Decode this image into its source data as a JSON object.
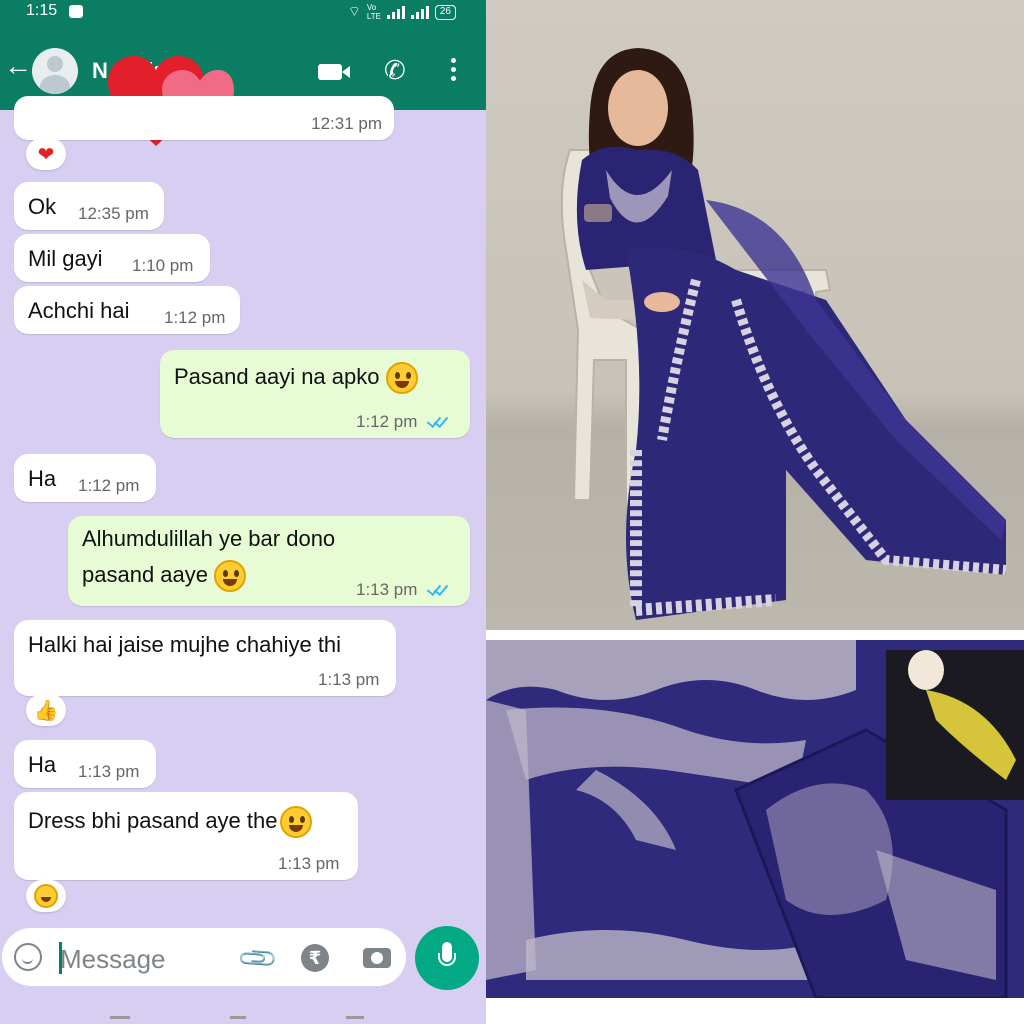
{
  "status_bar": {
    "time": "1:15",
    "network": "Vo LTE",
    "battery": "26"
  },
  "header": {
    "contact_name": "N e Ak..."
  },
  "messages": [
    {
      "dir": "in",
      "text": "",
      "time": "12:31 pm"
    },
    {
      "dir": "in",
      "text": "Ok",
      "time": "12:35 pm"
    },
    {
      "dir": "in",
      "text": "Mil gayi",
      "time": "1:10 pm"
    },
    {
      "dir": "in",
      "text": "Achchi hai",
      "time": "1:12 pm"
    },
    {
      "dir": "out",
      "text": "Pasand aayi na apko",
      "time": "1:12 pm"
    },
    {
      "dir": "in",
      "text": "Ha",
      "time": "1:12 pm"
    },
    {
      "dir": "out",
      "text_line1": "Alhumdulillah ye bar dono",
      "text_line2": "pasand aaye",
      "time": "1:13 pm"
    },
    {
      "dir": "in",
      "text": "Halki hai jaise mujhe chahiye thi",
      "time": "1:13 pm"
    },
    {
      "dir": "in",
      "text": "Ha",
      "time": "1:13 pm"
    },
    {
      "dir": "in",
      "text": "Dress bhi pasand aye the",
      "time": "1:13 pm"
    }
  ],
  "reactions": [
    "heart",
    "thumbs-up",
    "grinning-face"
  ],
  "input": {
    "placeholder": "Message",
    "rupee_symbol": "₹"
  },
  "colors": {
    "header_green": "#0a7d62",
    "chat_bg": "#d7cef2",
    "outgoing_bubble": "#e7fbd5",
    "mic_button": "#03a884",
    "saree_purple": "#2f2a7c"
  }
}
